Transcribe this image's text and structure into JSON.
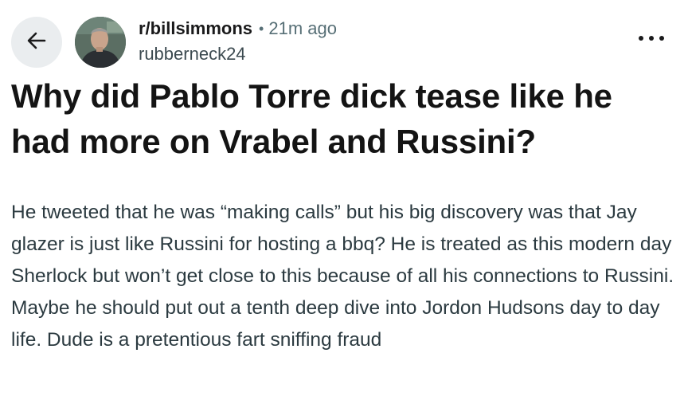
{
  "header": {
    "back_icon": "arrow-left-icon",
    "subreddit": "r/billsimmons",
    "separator": "•",
    "time_ago": "21m ago",
    "username": "rubberneck24",
    "more_icon": "more-horizontal-icon"
  },
  "post": {
    "title": "Why did Pablo Torre dick tease like he had more on Vrabel and Russini?",
    "body": "He tweeted that he was “making calls” but his big discovery was that Jay glazer is just like Russini for hosting a bbq? He is treated as this modern day Sherlock but won’t get close to this because of all his connections to Russini. Maybe he should put out a tenth deep dive into Jordon Hudsons day to day life. Dude is a pretentious fart sniffing fraud"
  },
  "colors": {
    "back_button_bg": "#eaedef",
    "meta_gray": "#576f76",
    "text_dark": "#1a1a1b"
  }
}
